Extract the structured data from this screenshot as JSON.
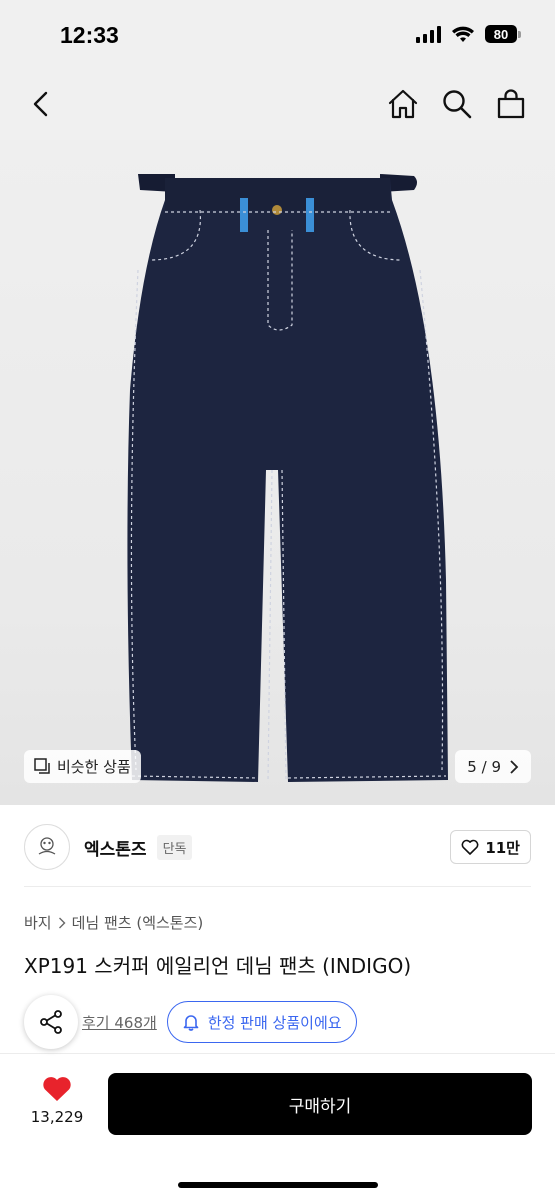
{
  "status": {
    "time": "12:33",
    "battery": "80"
  },
  "nav": {
    "back_icon": "chevron-left-icon",
    "home_icon": "home-icon",
    "search_icon": "search-icon",
    "bag_icon": "shopping-bag-icon"
  },
  "gallery": {
    "similar_label": "비슷한 상품",
    "page_current": "5",
    "page_total": "9",
    "page_separator": "/"
  },
  "brand": {
    "name": "엑스톤즈",
    "badge": "단독",
    "likes": "11만"
  },
  "product": {
    "breadcrumb": [
      "바지",
      "데님 팬츠 (엑스톤즈)"
    ],
    "title": "XP191 스커퍼 에일리언 데님 팬츠 (INDIGO)",
    "review_label": "후기 468개",
    "limited_label": "한정 판매 상품이에요"
  },
  "bottom": {
    "wish_count": "13,229",
    "buy_label": "구매하기"
  },
  "colors": {
    "accent_blue": "#3b67f0",
    "heart_red": "#e8232c",
    "denim": "#1d2540"
  }
}
